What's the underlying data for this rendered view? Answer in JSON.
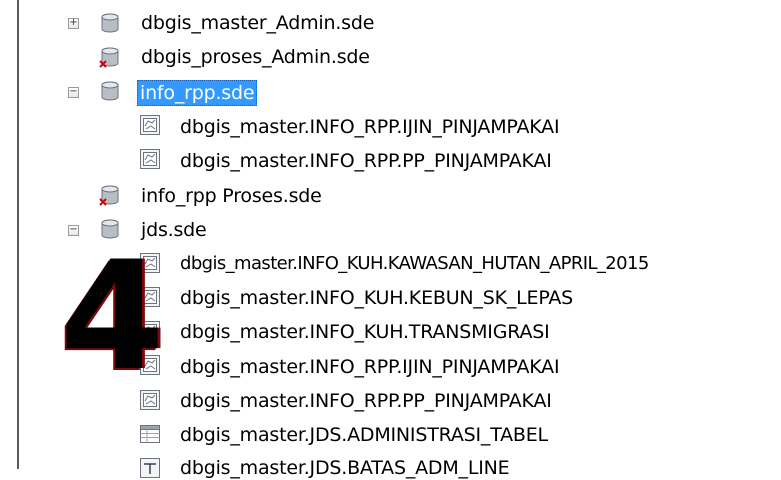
{
  "overlay_digit": "4",
  "tree": [
    {
      "label": "dbgis_master_Admin.sde",
      "icon": "database-connection-icon",
      "expander": "+"
    },
    {
      "label": "dbgis_proses_Admin.sde",
      "icon": "database-connection-error-icon",
      "expander": ""
    },
    {
      "label": "info_rpp.sde",
      "icon": "database-connection-icon",
      "expander": "−",
      "selected": true
    },
    {
      "label": "dbgis_master.INFO_RPP.IJIN_PINJAMPAKAI",
      "icon": "feature-class-icon"
    },
    {
      "label": "dbgis_master.INFO_RPP.PP_PINJAMPAKAI",
      "icon": "feature-class-icon"
    },
    {
      "label": "info_rpp Proses.sde",
      "icon": "database-connection-error-icon",
      "expander": ""
    },
    {
      "label": "jds.sde",
      "icon": "database-connection-icon",
      "expander": "−"
    },
    {
      "label": "dbgis_master.INFO_KUH.KAWASAN_HUTAN_APRIL_2015",
      "icon": "feature-class-icon"
    },
    {
      "label": "dbgis_master.INFO_KUH.KEBUN_SK_LEPAS",
      "icon": "feature-class-icon"
    },
    {
      "label": "dbgis_master.INFO_KUH.TRANSMIGRASI",
      "icon": "feature-class-icon"
    },
    {
      "label": "dbgis_master.INFO_RPP.IJIN_PINJAMPAKAI",
      "icon": "feature-class-icon"
    },
    {
      "label": "dbgis_master.INFO_RPP.PP_PINJAMPAKAI",
      "icon": "feature-class-icon"
    },
    {
      "label": "dbgis_master.JDS.ADMINISTRASI_TABEL",
      "icon": "table-icon"
    },
    {
      "label": "dbgis_master.JDS.BATAS_ADM_LINE",
      "icon": "line-feature-class-icon"
    }
  ]
}
